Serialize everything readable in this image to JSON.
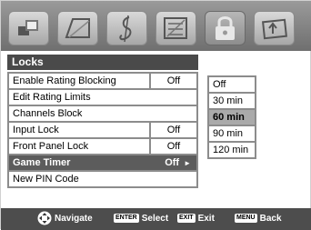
{
  "menu_icons": [
    "picture-icon",
    "sound-icon",
    "music-icon",
    "setup-icon",
    "lock-icon",
    "applications-icon"
  ],
  "panel": {
    "title": "Locks",
    "items": [
      {
        "label": "Enable Rating Blocking",
        "value": "Off"
      },
      {
        "label": "Edit Rating Limits",
        "value": ""
      },
      {
        "label": "Channels Block",
        "value": ""
      },
      {
        "label": "Input Lock",
        "value": "Off"
      },
      {
        "label": "Front Panel Lock",
        "value": "Off"
      },
      {
        "label": "Game Timer",
        "value": "Off",
        "selected": true
      },
      {
        "label": "New PIN Code",
        "value": ""
      }
    ]
  },
  "game_timer_options": {
    "items": [
      "Off",
      "30 min",
      "60 min",
      "90 min",
      "120 min"
    ],
    "selected": "60 min"
  },
  "navbar": {
    "navigate_label": "Navigate",
    "enter_key": "ENTER",
    "select_label": "Select",
    "exit_key": "EXIT",
    "exit_label": "Exit",
    "menu_key": "MENU",
    "back_label": "Back"
  }
}
